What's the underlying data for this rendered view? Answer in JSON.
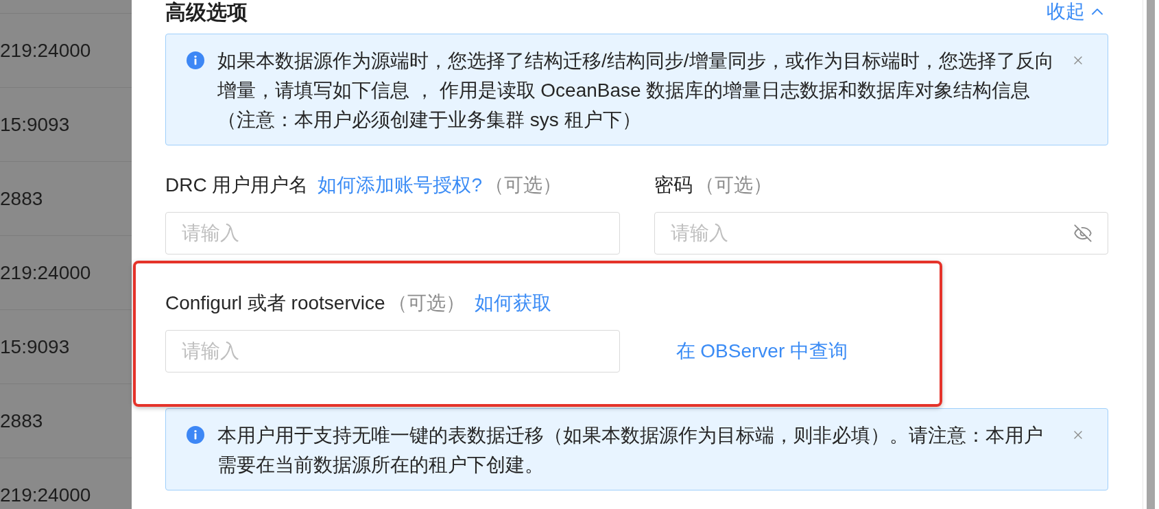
{
  "background_list": {
    "rows": [
      "219:24000",
      "15:9093",
      "2883",
      "219:24000",
      "15:9093",
      "2883",
      "219:24000"
    ]
  },
  "panel": {
    "title": "高级选项",
    "collapse_toggle": {
      "label": "收起",
      "expanded": true
    },
    "blocks": [
      {
        "kind": "alert",
        "closable": true,
        "text": "如果本数据源作为源端时，您选择了结构迁移/结构同步/增量同步，或作为目标端时，您选择了反向增量，请填写如下信息 ， 作用是读取 OceanBase 数据库的增量日志数据和数据库对象结构信息（注意：本用户必须创建于业务集群 sys 租户下）"
      },
      {
        "kind": "field_row",
        "highlighted": false,
        "cells": [
          {
            "kind": "field",
            "label_parts": [
              {
                "kind": "text",
                "text": "DRC 用户用户名"
              },
              {
                "kind": "link",
                "text": "如何添加账号授权?"
              },
              {
                "kind": "hint",
                "text": "（可选）"
              }
            ],
            "input": {
              "kind": "text",
              "placeholder": "请输入"
            }
          },
          {
            "kind": "field",
            "label_parts": [
              {
                "kind": "text",
                "text": "密码"
              },
              {
                "kind": "hint",
                "text": "（可选）"
              }
            ],
            "input": {
              "kind": "password",
              "placeholder": "请输入"
            }
          }
        ]
      },
      {
        "kind": "field_row",
        "highlighted": true,
        "cells": [
          {
            "kind": "field",
            "label_parts": [
              {
                "kind": "text",
                "text": "Configurl 或者 rootservice"
              },
              {
                "kind": "hint",
                "text": "（可选）"
              },
              {
                "kind": "link",
                "text": "如何获取"
              }
            ],
            "input": {
              "kind": "text",
              "placeholder": "请输入"
            }
          },
          {
            "kind": "link",
            "text": "在 OBServer 中查询"
          }
        ]
      },
      {
        "kind": "alert",
        "closable": true,
        "text": "本用户用于支持无唯一键的表数据迁移（如果本数据源作为目标端，则非必填）。请注意：本用户需要在当前数据源所在的租户下创建。"
      }
    ]
  }
}
